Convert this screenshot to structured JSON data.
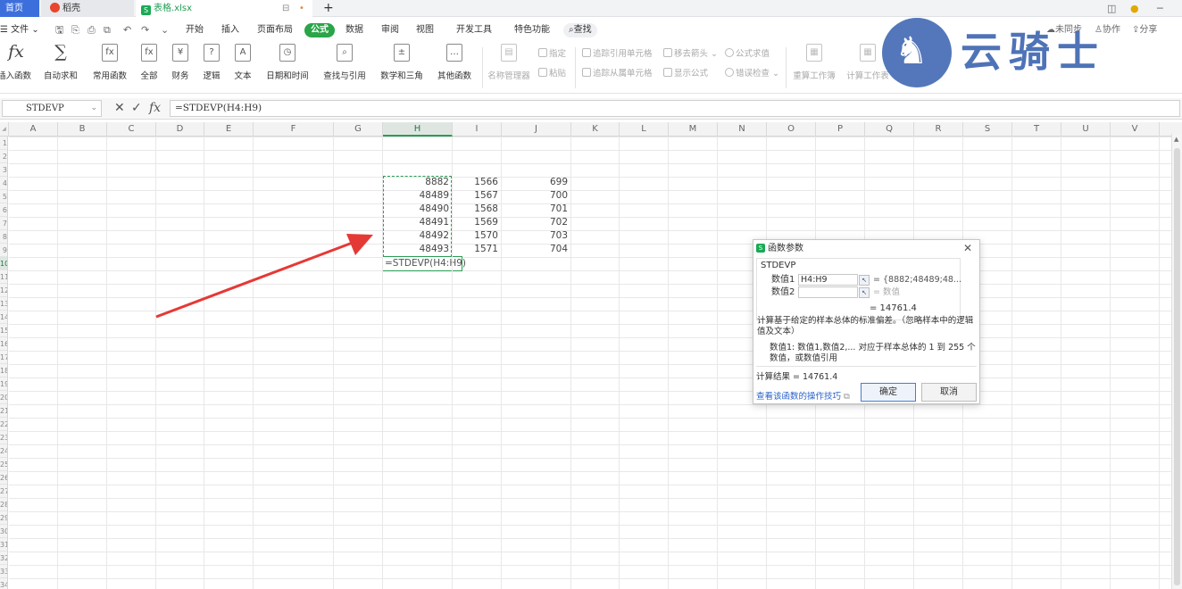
{
  "tabs": {
    "home": "首页",
    "daoke": "稻壳",
    "file": "表格.xlsx",
    "new_tab": "+",
    "dot": "•"
  },
  "menubar": {
    "file_menu": "文件",
    "items": [
      "开始",
      "插入",
      "页面布局",
      "公式",
      "数据",
      "审阅",
      "视图",
      "开发工具",
      "特色功能"
    ],
    "active_index": 3,
    "search": "查找",
    "right": {
      "sync": "未同步",
      "collab": "协作",
      "share": "分享"
    }
  },
  "ribbon": {
    "buttons": [
      {
        "label": "插入函数",
        "icon": "fx"
      },
      {
        "label": "自动求和",
        "icon": "∑"
      },
      {
        "label": "常用函数",
        "icon": "fx"
      },
      {
        "label": "全部",
        "icon": "fx"
      },
      {
        "label": "财务",
        "icon": "¥"
      },
      {
        "label": "逻辑",
        "icon": "?"
      },
      {
        "label": "文本",
        "icon": "A"
      },
      {
        "label": "日期和时间",
        "icon": "◷"
      },
      {
        "label": "查找与引用",
        "icon": "⌕"
      },
      {
        "label": "数学和三角",
        "icon": "±"
      },
      {
        "label": "其他函数",
        "icon": "…"
      }
    ],
    "name_manager": "名称管理器",
    "define": "指定",
    "paste": "粘贴",
    "trace_precedents": "追踪引用单元格",
    "trace_dependents": "追踪从属单元格",
    "remove_arrows": "移去箭头",
    "show_formulas": "显示公式",
    "evaluate": "公式求值",
    "error_check": "错误检查",
    "recalc_sheet": "重算工作簿",
    "calc_sheet": "计算工作表"
  },
  "watermark": {
    "text": "云骑士"
  },
  "formula_bar": {
    "name_box": "STDEVP",
    "formula": "=STDEVP(H4:H9)",
    "cancel_icon": "✕",
    "confirm_icon": "✓",
    "fx_label": "fx"
  },
  "columns": [
    "A",
    "B",
    "C",
    "D",
    "E",
    "F",
    "G",
    "H",
    "I",
    "J",
    "K",
    "L",
    "M",
    "N",
    "O",
    "P",
    "Q",
    "R",
    "S",
    "T",
    "U",
    "V"
  ],
  "selected_column": "H",
  "rows": [
    "1",
    "2",
    "3",
    "4",
    "5",
    "6",
    "7",
    "8",
    "9",
    "10",
    "11",
    "12",
    "13",
    "14",
    "15",
    "16",
    "17",
    "18",
    "19",
    "20",
    "21",
    "22",
    "23",
    "24",
    "25",
    "26",
    "27",
    "28",
    "29",
    "30",
    "31",
    "32",
    "33",
    "34"
  ],
  "selected_row": "10",
  "cells": {
    "h": [
      "8882",
      "48489",
      "48490",
      "48491",
      "48492",
      "48493"
    ],
    "i": [
      "1566",
      "1567",
      "1568",
      "1569",
      "1570",
      "1571"
    ],
    "j": [
      "699",
      "700",
      "701",
      "702",
      "703",
      "704"
    ],
    "active": "=STDEVP(H4:H9)"
  },
  "dialog": {
    "title": "函数参数",
    "function_name": "STDEVP",
    "arg1_label": "数值1",
    "arg1_value": "H4:H9",
    "arg1_result": "= {8882;48489;48...",
    "arg2_label": "数值2",
    "arg2_value": "",
    "arg2_result": "= 数值",
    "result_mid": "= 14761.4",
    "description": "计算基于给定的样本总体的标准偏差。（忽略样本中的逻辑值及文本）",
    "arg_desc": "数值1: 数值1,数值2,... 对应于样本总体的 1 到 255 个数值，或数值引用",
    "calc_result": "计算结果 = 14761.4",
    "help_link": "查看该函数的操作技巧",
    "ok": "确定",
    "cancel": "取消",
    "close_icon": "✕"
  },
  "colors": {
    "accent_green": "#2aa548",
    "tab_blue": "#3d6fdc",
    "arrow_red": "#e53935",
    "watermark_blue": "#3b64b0"
  }
}
